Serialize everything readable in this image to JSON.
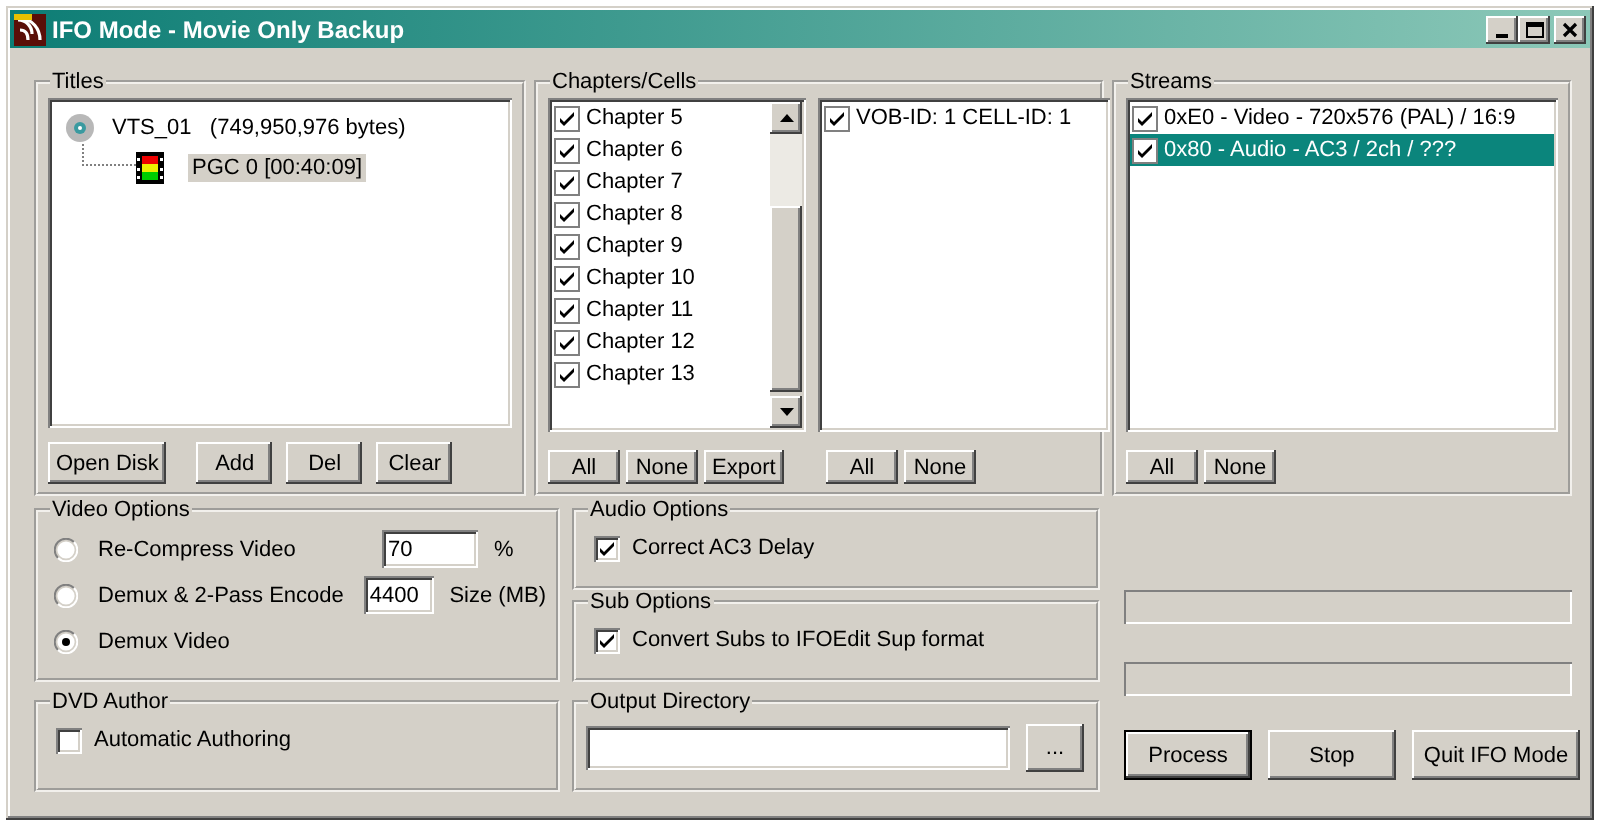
{
  "window": {
    "title": "IFO Mode - Movie Only Backup"
  },
  "titles": {
    "label": "Titles",
    "tree": [
      {
        "kind": "disc",
        "label": "VTS_01   (749,950,976 bytes)",
        "selected": false,
        "children": [
          {
            "kind": "film",
            "label": "PGC 0 [00:40:09]",
            "selected": true
          }
        ]
      }
    ],
    "buttons": [
      "Open Disk",
      "Add",
      "Del",
      "Clear"
    ]
  },
  "chapters": {
    "label": "Chapters/Cells",
    "items": [
      {
        "label": "Chapter 5",
        "checked": true
      },
      {
        "label": "Chapter 6",
        "checked": true
      },
      {
        "label": "Chapter 7",
        "checked": true
      },
      {
        "label": "Chapter 8",
        "checked": true
      },
      {
        "label": "Chapter 9",
        "checked": true
      },
      {
        "label": "Chapter 10",
        "checked": true
      },
      {
        "label": "Chapter 11",
        "checked": true
      },
      {
        "label": "Chapter 12",
        "checked": true
      },
      {
        "label": "Chapter 13",
        "checked": true
      }
    ],
    "cells": [
      {
        "label": "VOB-ID: 1 CELL-ID: 1",
        "checked": true
      }
    ],
    "chapter_buttons": [
      "All",
      "None",
      "Export"
    ],
    "cell_buttons": [
      "All",
      "None"
    ]
  },
  "streams": {
    "label": "Streams",
    "items": [
      {
        "label": "0xE0 - Video - 720x576 (PAL) / 16:9",
        "checked": true,
        "selected": false
      },
      {
        "label": "0x80 - Audio - AC3 / 2ch / ???",
        "checked": true,
        "selected": true
      }
    ],
    "buttons": [
      "All",
      "None"
    ]
  },
  "video_options": {
    "label": "Video Options",
    "options": [
      {
        "label": "Re-Compress Video",
        "selected": false,
        "value": "70",
        "unit": "%"
      },
      {
        "label": "Demux & 2-Pass Encode",
        "selected": false,
        "value": "4400",
        "unit": "Size (MB)"
      },
      {
        "label": "Demux Video",
        "selected": true
      }
    ]
  },
  "dvd_author": {
    "label": "DVD Author",
    "options": [
      {
        "label": "Automatic Authoring",
        "checked": false
      }
    ]
  },
  "audio_options": {
    "label": "Audio Options",
    "options": [
      {
        "label": "Correct AC3 Delay",
        "checked": true
      }
    ]
  },
  "sub_options": {
    "label": "Sub Options",
    "options": [
      {
        "label": "Convert Subs to IFOEdit Sup format",
        "checked": true
      }
    ]
  },
  "output_directory": {
    "label": "Output Directory",
    "browse_button": "..."
  },
  "progress": [
    {
      "level": 0
    },
    {
      "level": 0
    }
  ],
  "actions": [
    {
      "label": "Process",
      "default": true
    },
    {
      "label": "Stop",
      "default": false
    },
    {
      "label": "Quit IFO Mode",
      "default": false
    }
  ]
}
